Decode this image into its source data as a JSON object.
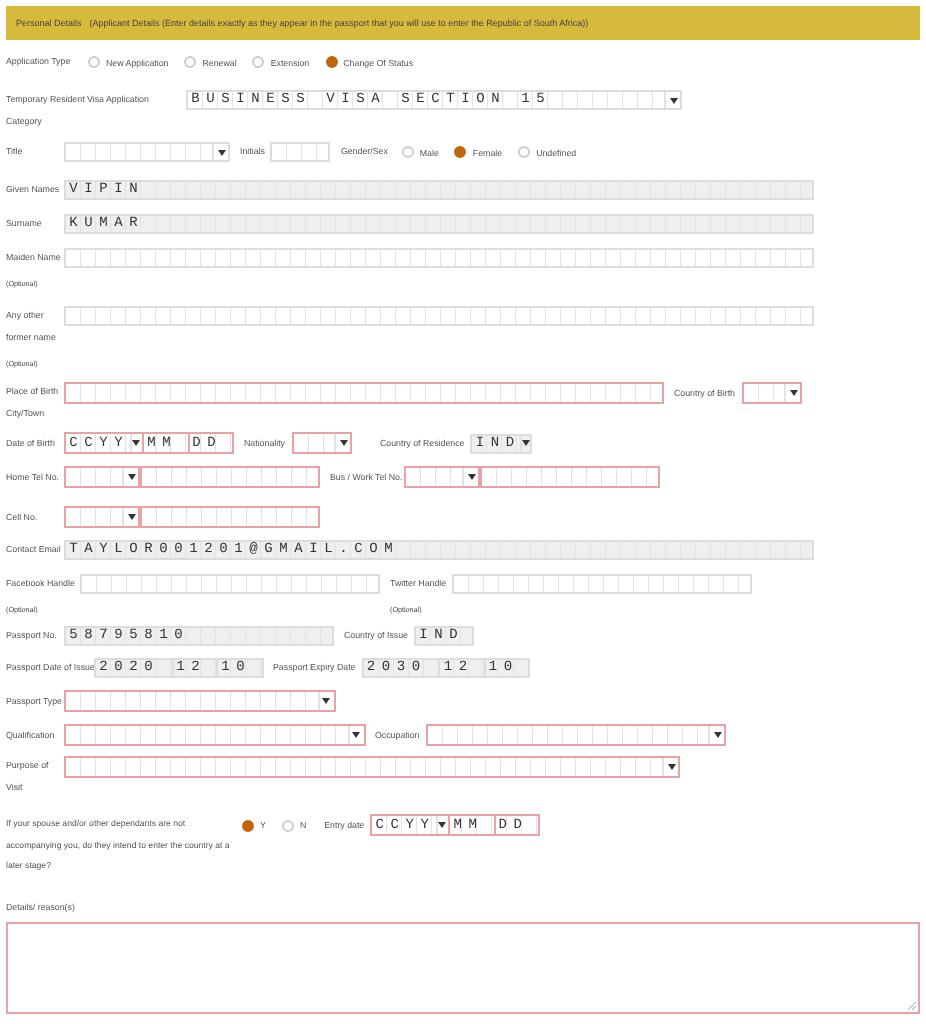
{
  "header": {
    "title": "Personal Details",
    "subtitle": "(Applicant Details (Enter details exactly as they appear in the passport that you will use to enter the Republic of South Africa))"
  },
  "application_type": {
    "label": "Application Type",
    "options": [
      {
        "label": "New Application",
        "selected": false
      },
      {
        "label": "Renewal",
        "selected": false
      },
      {
        "label": "Extension",
        "selected": false
      },
      {
        "label": "Change Of Status",
        "selected": true
      }
    ]
  },
  "visa_category": {
    "label": "Temporary Resident Visa Application",
    "label_line_2": "Category",
    "value": "BUSINESS VISA SECTION 15",
    "required": false,
    "readonly": false
  },
  "title": {
    "label": "Title",
    "required": false,
    "readonly": false
  },
  "initials": {
    "label": "Initials",
    "required": false,
    "readonly": false
  },
  "gender": {
    "label": "Gender/Sex",
    "options": [
      {
        "label": "Male",
        "selected": false
      },
      {
        "label": "Female",
        "selected": true
      },
      {
        "label": "Undefined",
        "selected": false
      }
    ]
  },
  "given_names": {
    "label": "Given Names",
    "value": "VIPIN",
    "required": false,
    "readonly": true
  },
  "surname": {
    "label": "Surname",
    "value": "KUMAR",
    "required": false,
    "readonly": true
  },
  "maiden_name": {
    "label": "Maiden Name",
    "note": "(Optional)",
    "required": false,
    "readonly": false
  },
  "former_name": {
    "label": "Any other",
    "label_line_2": "former name",
    "note": "(Optional)",
    "required": false,
    "readonly": false
  },
  "place_of_birth": {
    "label": "Place of Birth",
    "label_line_2": "City/Town",
    "required": true,
    "readonly": false
  },
  "country_of_birth": {
    "label": "Country of Birth",
    "required": true,
    "readonly": false
  },
  "date_of_birth": {
    "label": "Date of Birth",
    "year": "CCYY",
    "month": "MM",
    "day": "DD",
    "required": true,
    "readonly": false
  },
  "nationality": {
    "label": "Nationality",
    "required": true,
    "readonly": false
  },
  "country_of_residence": {
    "label": "Country of Residence",
    "value": "IND",
    "required": false,
    "readonly": true
  },
  "home_tel": {
    "label": "Home Tel No.",
    "required": true,
    "readonly": false
  },
  "work_tel": {
    "label": "Bus / Work Tel No.",
    "required": true,
    "readonly": false
  },
  "cell": {
    "label": "Cell No.",
    "required": true,
    "readonly": false
  },
  "email": {
    "label": "Contact Email",
    "value": "TAYLOR001201@GMAIL.COM",
    "required": false,
    "readonly": true
  },
  "facebook": {
    "label": "Facebook Handle",
    "note": "(Optional)",
    "required": false,
    "readonly": false
  },
  "twitter": {
    "label": "Twitter Handle",
    "note": "(Optional)",
    "required": false,
    "readonly": false
  },
  "passport_no": {
    "label": "Passport No.",
    "value": "58795810",
    "required": false,
    "readonly": true
  },
  "country_of_issue": {
    "label": "Country of Issue",
    "value": "IND",
    "required": false,
    "readonly": true
  },
  "passport_issue": {
    "label": "Passport Date of Issue",
    "year": "2020",
    "month": "12",
    "day": "10",
    "required": false,
    "readonly": true
  },
  "passport_expiry": {
    "label": "Passport Expiry Date",
    "year": "2030",
    "month": "12",
    "day": "10",
    "required": false,
    "readonly": true
  },
  "passport_type": {
    "label": "Passport Type",
    "required": true,
    "readonly": false
  },
  "qualification": {
    "label": "Qualification",
    "required": true,
    "readonly": false
  },
  "occupation": {
    "label": "Occupation",
    "required": true,
    "readonly": false
  },
  "purpose": {
    "label": "Purpose of",
    "label_line_2": "Visit",
    "required": true,
    "readonly": false
  },
  "spouse_question": {
    "text": "If your spouse and/or other dependants are not accompanying you, do they intend to enter the country at a later stage?",
    "options": [
      {
        "label": "Y",
        "selected": true
      },
      {
        "label": "N",
        "selected": false
      }
    ]
  },
  "entry_date": {
    "label": "Entry date",
    "year": "CCYY",
    "month": "MM",
    "day": "DD",
    "required": true,
    "readonly": false
  },
  "details": {
    "label": "Details/ reason(s)",
    "required": true
  }
}
